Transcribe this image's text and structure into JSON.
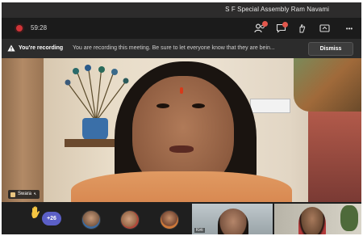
{
  "window": {
    "title": "S F Special Assembly Ram Navami"
  },
  "toolbar": {
    "timer": "59:28",
    "participants_count": "",
    "icons": [
      "participants-icon",
      "chat-icon",
      "reactions-icon",
      "share-icon",
      "more-icon"
    ],
    "more_label": "•••"
  },
  "banner": {
    "label": "You're recording",
    "message": "You are recording this meeting. Be sure to let everyone know that they are bein...",
    "dismiss_label": "Dismiss"
  },
  "main_video": {
    "speaker_name": "Swara"
  },
  "gallery": {
    "overflow_count": "+26",
    "tiles": [
      {
        "name": "Kirti"
      },
      {
        "name": ""
      }
    ]
  },
  "colors": {
    "recording_dot": "#d13438",
    "accent": "#5b5fc7",
    "background": "#1f1f1f"
  }
}
